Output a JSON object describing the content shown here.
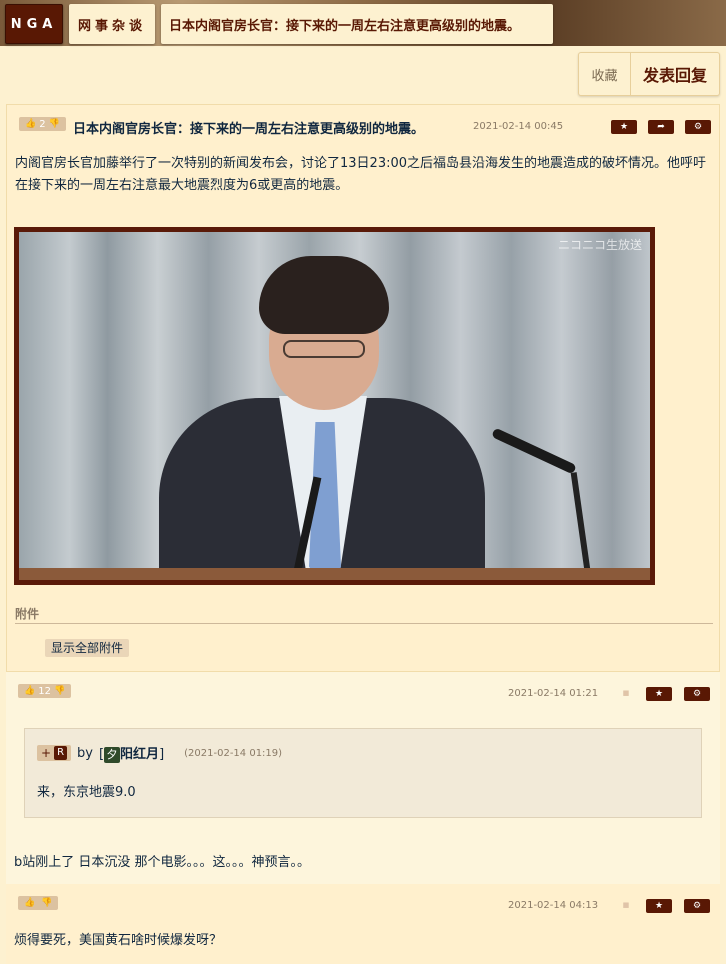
{
  "site": {
    "logo": "NGA",
    "forum": "网事杂谈",
    "thread_title": "日本内阁官房长官：接下来的一周左右注意更高级别的地震。"
  },
  "actions": {
    "favorite": "收藏",
    "reply": "发表回复"
  },
  "posts": [
    {
      "vote": "2",
      "title": "日本内阁官房长官：接下来的一周左右注意更高级别的地震。",
      "time": "2021-02-14 00:45",
      "content": "内阁官房长官加藤举行了一次特别的新闻发布会，讨论了13日23:00之后福岛县沿海发生的地震造成的破坏情况。他呼吁在接下来的一周左右注意最大地震烈度为6或更高的地震。",
      "image_watermark": "ニコニコ生放送",
      "attachments_label": "附件",
      "show_all_attachments": "显示全部附件"
    },
    {
      "vote": "12",
      "time": "2021-02-14 01:21",
      "quote": {
        "plus": "+",
        "badge": "R",
        "by": "by",
        "avatar": "夕",
        "user": "阳红月",
        "time": "(2021-02-14 01:19)",
        "text": "来，东京地震9.0"
      },
      "content": "b站刚上了 日本沉没 那个电影。。。这。。。神预言。。"
    },
    {
      "vote": "",
      "time": "2021-02-14 04:13",
      "content": "烦得要死，美国黄石啥时候爆发呀？"
    }
  ],
  "icons": {
    "like": "thumbs-up-icon",
    "dislike": "thumbs-down-icon",
    "star": "star-icon",
    "share": "share-icon",
    "settings": "gear-icon",
    "device_apple": "apple-icon",
    "device_android": "android-icon"
  },
  "colors": {
    "accent": "#591804",
    "background": "#fdf1d0",
    "text": "#10273f"
  }
}
